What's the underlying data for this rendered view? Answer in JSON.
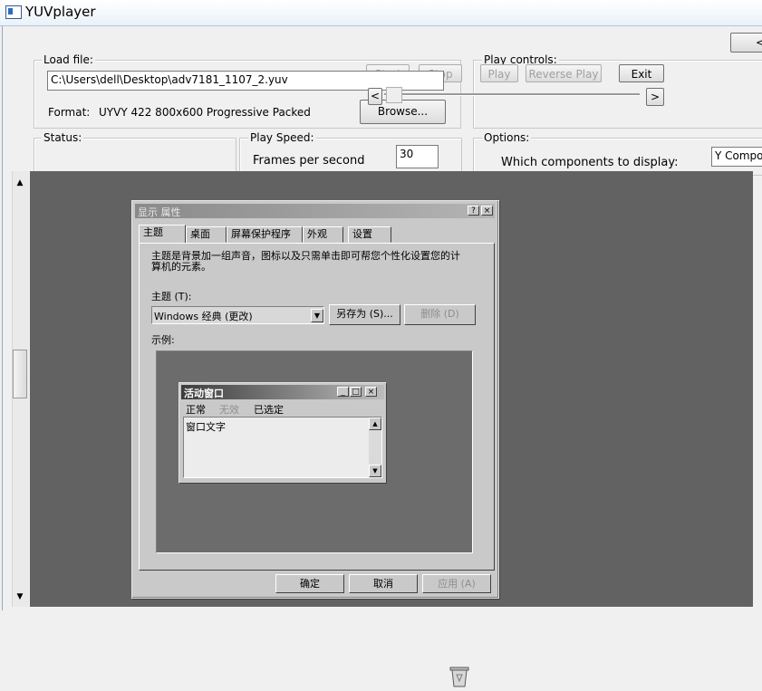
{
  "app": {
    "title": "YUVplayer"
  },
  "load_file": {
    "label": "Load file:",
    "path": "C:\\Users\\dell\\Desktop\\adv7181_1107_2.yuv",
    "format_label": "Format:",
    "format_value": "UYVY 422  800x600 Progressive Packed",
    "browse_label": "Browse...",
    "start_label": "Start",
    "stop_label": "Stop"
  },
  "play_controls": {
    "label": "Play controls:",
    "play_label": "Play",
    "reverse_label": "Reverse Play",
    "exit_label": "Exit",
    "prev_label": "<",
    "next_label": ">",
    "top_right_label": "<-"
  },
  "status": {
    "label": "Status:"
  },
  "play_speed": {
    "label": "Play Speed:",
    "fps_label": "Frames per second",
    "fps_value": "30"
  },
  "options": {
    "label": "Options:",
    "components_label": "Which components to display:",
    "components_value": "Y Compo"
  },
  "scrollbar": {
    "up": "▲",
    "down": "▼"
  },
  "frame": {
    "dialog_title": "显示 属性",
    "help_btn": "?",
    "close_btn": "×",
    "tabs": [
      "主题",
      "桌面",
      "屏幕保护程序",
      "外观",
      "设置"
    ],
    "description": "主题是背景加一组声音，图标以及只需单击即可帮您个性化设置您的计算机的元素。",
    "theme_label": "主题 (T):",
    "theme_value": "Windows 经典 (更改)",
    "save_as_label": "另存为 (S)...",
    "delete_label": "删除 (D)",
    "sample_label": "示例:",
    "inner_window_title": "活动窗口",
    "inner_menu": [
      "正常",
      "无效",
      "已选定"
    ],
    "inner_text": "窗口文字",
    "ok_label": "确定",
    "cancel_label": "取消",
    "apply_label": "应用 (A)"
  }
}
